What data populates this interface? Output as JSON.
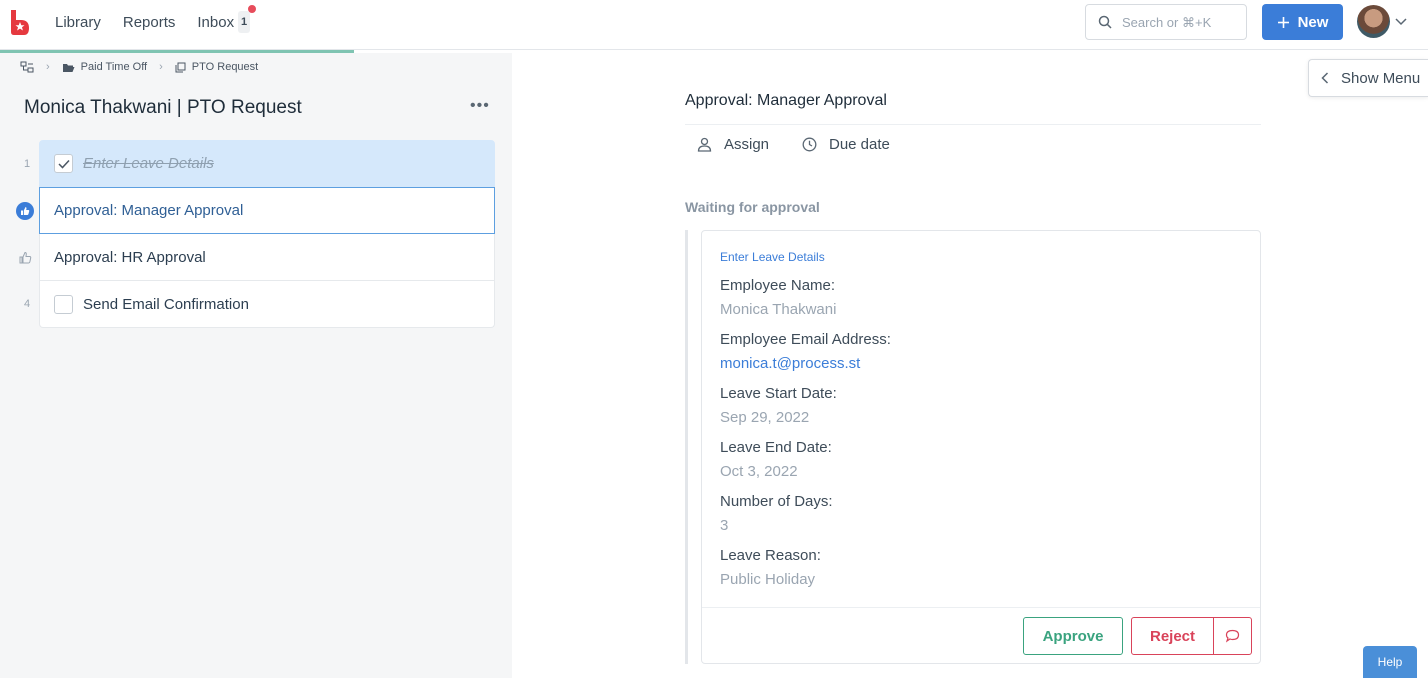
{
  "nav": {
    "library": "Library",
    "reports": "Reports",
    "inbox": "Inbox",
    "inbox_count": "1"
  },
  "search": {
    "placeholder": "Search or ⌘+K"
  },
  "new_button": "New",
  "breadcrumb": {
    "folder": "Paid Time Off",
    "template": "PTO Request"
  },
  "checklist": {
    "title": "Monica Thakwani | PTO Request",
    "tasks": [
      {
        "number": "1",
        "label": "Enter Leave Details",
        "state": "done"
      },
      {
        "number": "",
        "label": "Approval: Manager Approval",
        "state": "active"
      },
      {
        "number": "",
        "label": "Approval: HR Approval",
        "state": "pending"
      },
      {
        "number": "4",
        "label": "Send Email Confirmation",
        "state": "pending"
      }
    ]
  },
  "detail": {
    "title": "Approval: Manager Approval",
    "assign": "Assign",
    "due_date": "Due date",
    "status": "Waiting for approval",
    "card": {
      "subtask": "Enter Leave Details",
      "fields": [
        {
          "label": "Employee Name:",
          "value": "Monica Thakwani"
        },
        {
          "label": "Employee Email Address:",
          "value": "monica.t@process.st"
        },
        {
          "label": "Leave Start Date:",
          "value": "Sep 29, 2022"
        },
        {
          "label": "Leave End Date:",
          "value": "Oct 3, 2022"
        },
        {
          "label": "Number of Days:",
          "value": "3"
        },
        {
          "label": "Leave Reason:",
          "value": "Public Holiday"
        }
      ],
      "approve": "Approve",
      "reject": "Reject"
    }
  },
  "show_menu": "Show Menu",
  "help": "Help",
  "colors": {
    "primary": "#3b7dd8",
    "approve": "#3aa37f",
    "reject": "#d9435a",
    "done_bg": "#d5e8fb"
  }
}
